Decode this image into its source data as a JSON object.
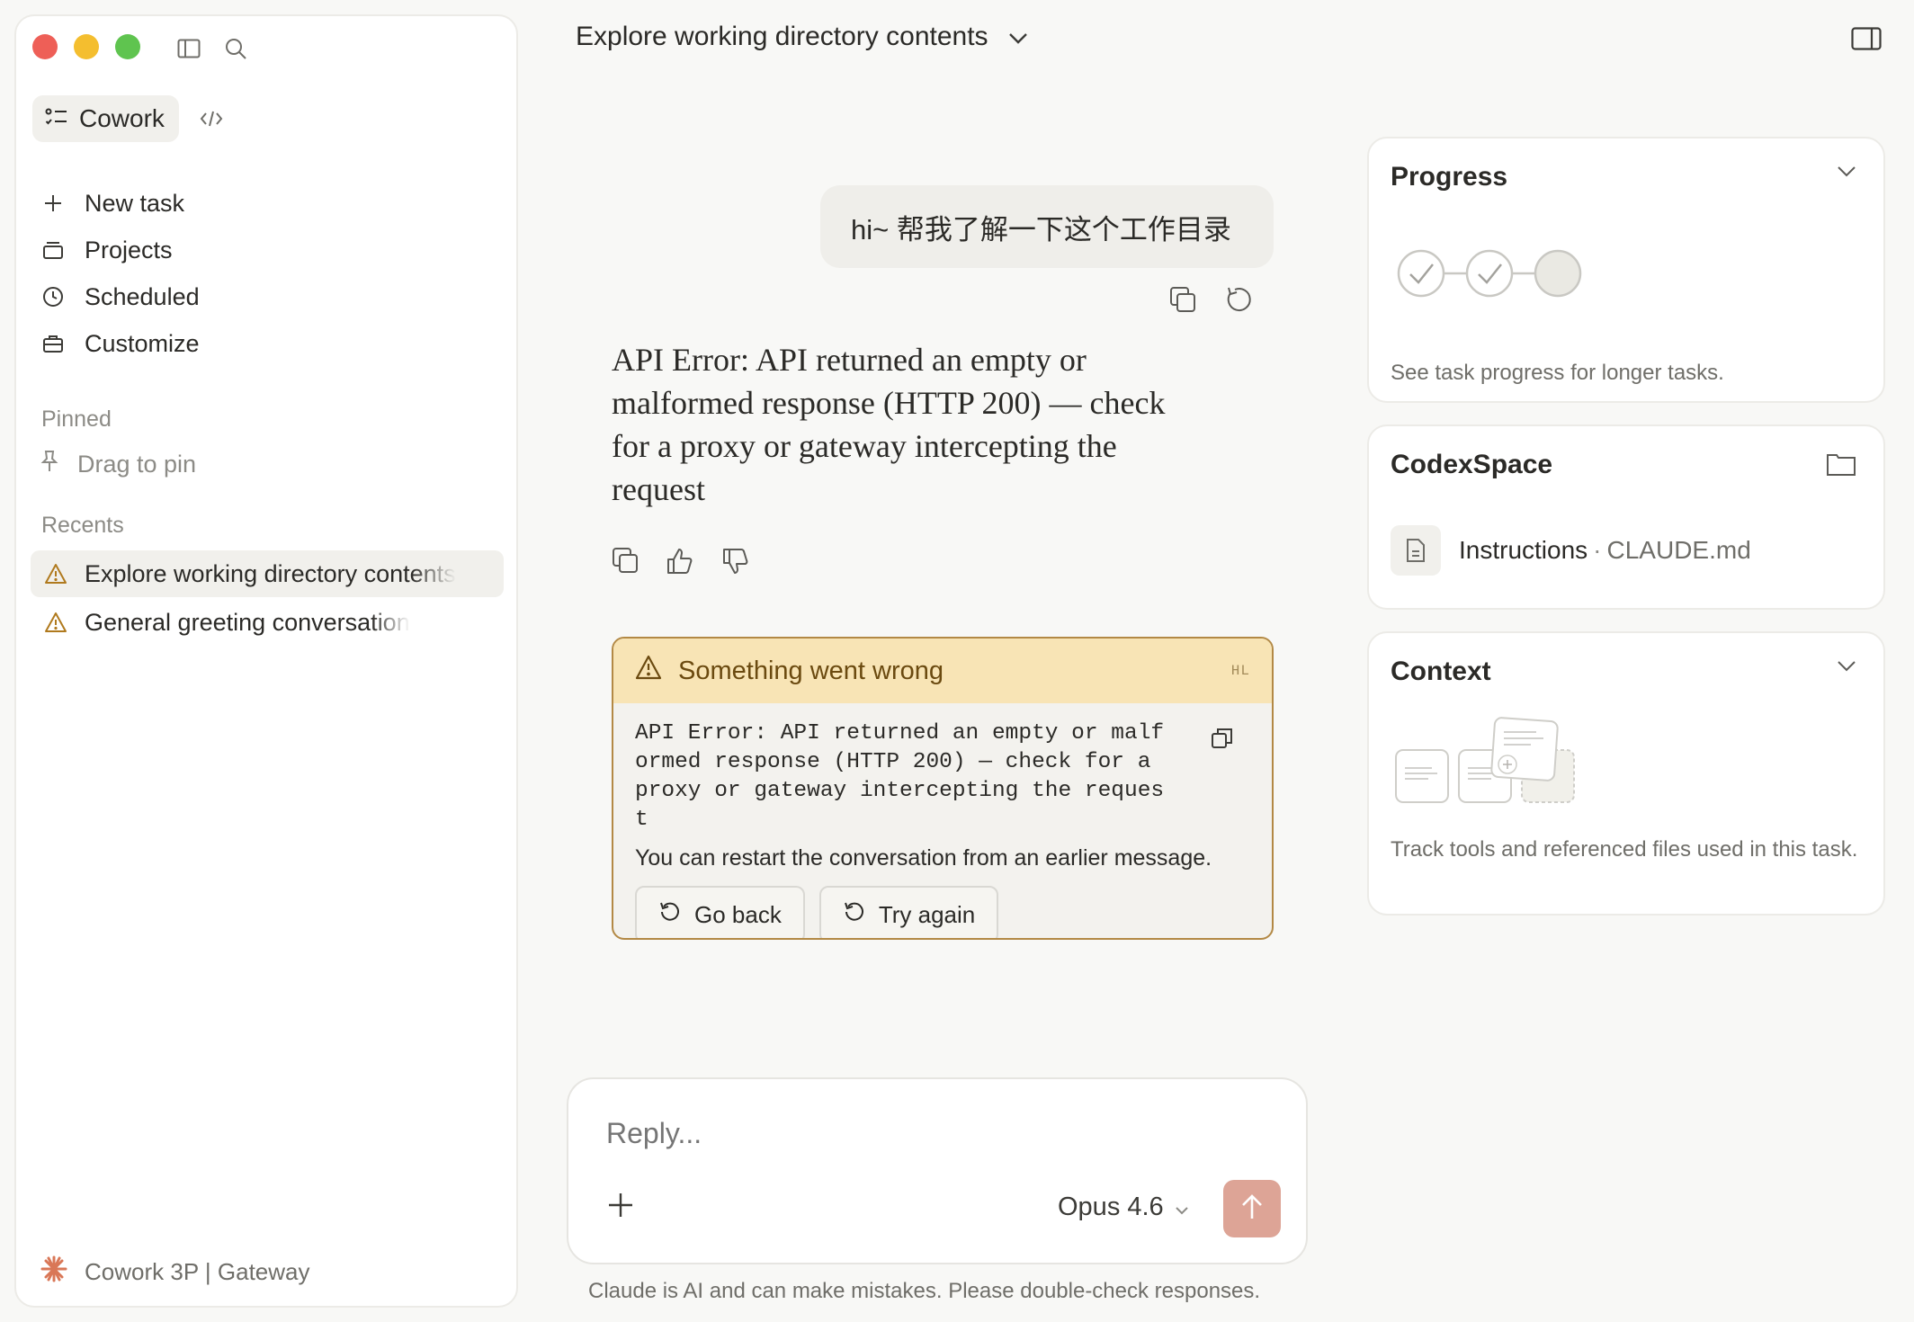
{
  "sidebar": {
    "mode_label": "Cowork",
    "nav": [
      {
        "label": "New task",
        "icon": "plus-icon"
      },
      {
        "label": "Projects",
        "icon": "folder-stack-icon"
      },
      {
        "label": "Scheduled",
        "icon": "clock-icon"
      },
      {
        "label": "Customize",
        "icon": "briefcase-icon"
      }
    ],
    "pinned_label": "Pinned",
    "pin_hint": "Drag to pin",
    "recents_label": "Recents",
    "recents": [
      {
        "label": "Explore working directory contents",
        "icon": "warning-icon",
        "active": true
      },
      {
        "label": "General greeting conversation",
        "icon": "warning-icon",
        "active": false
      }
    ],
    "footer": "Cowork 3P | Gateway"
  },
  "header": {
    "title": "Explore working directory contents"
  },
  "chat": {
    "user_message": "hi~ 帮我了解一下这个工作目录",
    "assistant_message": "API Error: API returned an empty or malformed response (HTTP 200) — check for a proxy or gateway intercepting the request"
  },
  "error": {
    "title": "Something went wrong",
    "tag": "HL",
    "detail": "API Error: API returned an empty or malformed response (HTTP 200) — check for a proxy or gateway intercepting the request",
    "hint": "You can restart the conversation from an earlier message.",
    "go_back": "Go back",
    "try_again": "Try again",
    "accent_color": "#B38945",
    "header_bg": "#F8E4B5"
  },
  "composer": {
    "placeholder": "Reply...",
    "model": "Opus 4.6",
    "send_color": "#DDA496"
  },
  "disclaimer": "Claude is AI and can make mistakes. Please double-check responses.",
  "panels": {
    "progress": {
      "title": "Progress",
      "description": "See task progress for longer tasks.",
      "steps": [
        "done",
        "done",
        "pending"
      ]
    },
    "workspace": {
      "title": "CodexSpace",
      "file_name": "Instructions",
      "separator": "·",
      "file_path": "CLAUDE.md"
    },
    "context": {
      "title": "Context",
      "description": "Track tools and referenced files used in this task."
    }
  }
}
